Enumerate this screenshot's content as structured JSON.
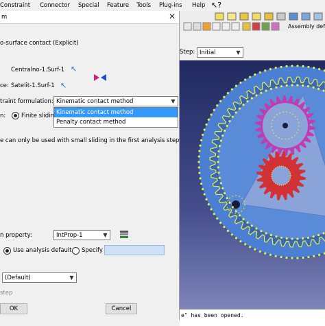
{
  "menubar": {
    "items": [
      "Constraint",
      "Connector",
      "Special",
      "Feature",
      "Tools",
      "Plug-ins",
      "Help"
    ],
    "help_arrow_icon": "help-pointer-icon"
  },
  "toolbar": {
    "assembly_label": "Assembly def"
  },
  "step_bar": {
    "label": "Step:",
    "value": "Initial"
  },
  "dialog": {
    "title_fragment": "m",
    "contact_type": "o-surface contact (Explicit)",
    "master_label": "",
    "master_value": "Centralno-1.Surf-1",
    "slave_label": "ce:",
    "slave_value": "Satelit-1.Surf-1",
    "constraint_label": "traint formulation:",
    "constraint_value": "Kinematic contact method",
    "dropdown_options": [
      "Kinematic contact method",
      "Penalty contact method"
    ],
    "sliding_label": "n:",
    "sliding_option": "Finite slidin",
    "note": "e can only be used with small sliding in the first analysis step.",
    "interaction_label": "n property:",
    "interaction_value": "IntProp-1",
    "use_default_label": "Use analysis default",
    "specify_label": "Specify",
    "default_value": "(Default)",
    "step_fragment": "step",
    "ok_label": "OK",
    "cancel_label": "Cancel"
  },
  "console": {
    "text": "e\" has been opened."
  },
  "colors": {
    "highlight": "#3399ff",
    "viewport_top": "#202a60",
    "gear_blue": "#4a7fd4",
    "gear_magenta": "#c23bb0",
    "gear_red": "#d23236",
    "node_yellow": "#e9f03b"
  }
}
